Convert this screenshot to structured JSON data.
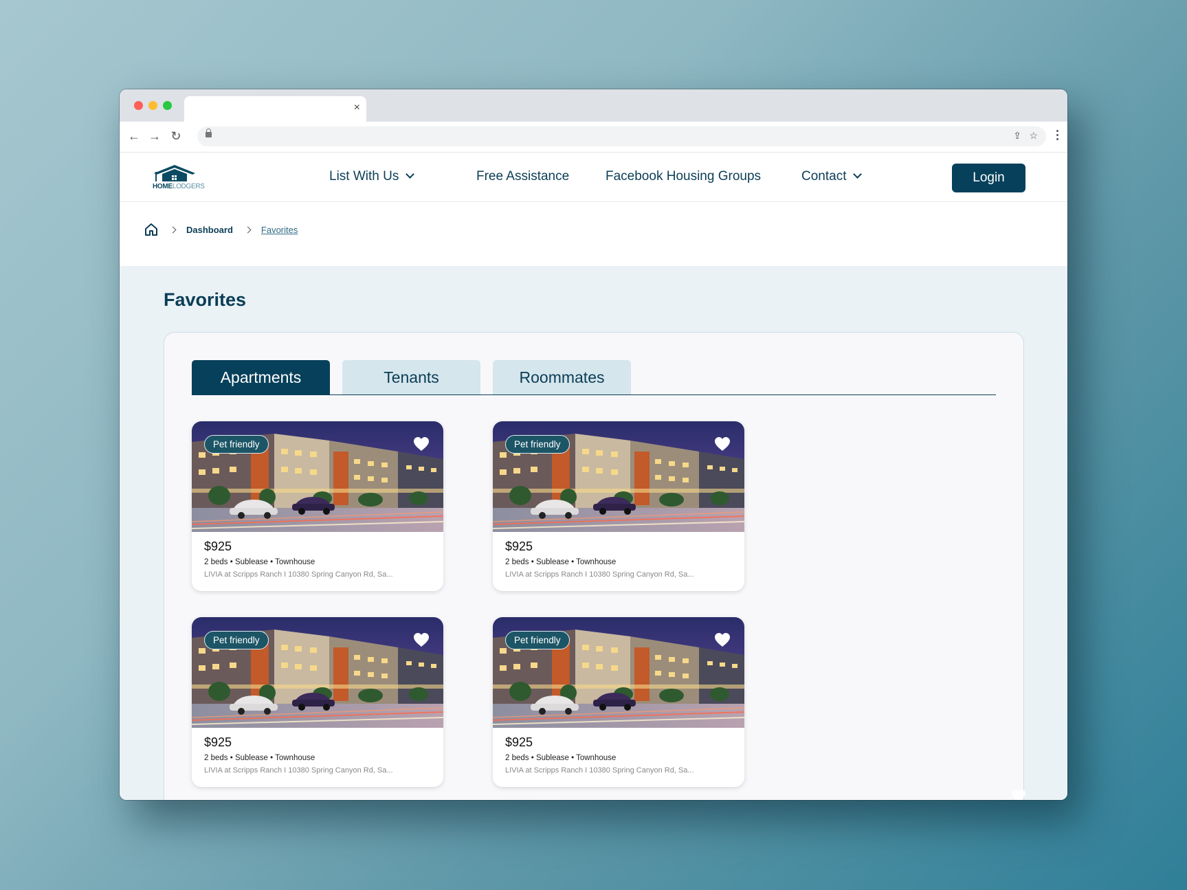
{
  "colors": {
    "brand_dark": "#07405a",
    "text_navy": "#0b3d56",
    "tab_inactive": "#d5e6ec",
    "badge": "#1c5566",
    "page_bg": "#eaf2f5"
  },
  "browser": {
    "tab_title": "",
    "close_glyph": "×",
    "back_glyph": "←",
    "forward_glyph": "→",
    "reload_glyph": "↻",
    "share_glyph": "⇪",
    "star_glyph": "☆"
  },
  "logo": {
    "text_bold": "HOME",
    "text_light": "LODGERS"
  },
  "nav": {
    "items": [
      {
        "label": "List With Us",
        "has_dropdown": true
      },
      {
        "label": "Free Assistance",
        "has_dropdown": false
      },
      {
        "label": "Facebook Housing Groups",
        "has_dropdown": false
      },
      {
        "label": "Contact",
        "has_dropdown": true
      }
    ],
    "login_label": "Login"
  },
  "breadcrumb": {
    "dashboard": "Dashboard",
    "current": "Favorites"
  },
  "page": {
    "title": "Favorites"
  },
  "tabs": [
    {
      "label": "Apartments",
      "active": true
    },
    {
      "label": "Tenants",
      "active": false
    },
    {
      "label": "Roommates",
      "active": false
    }
  ],
  "listings": [
    {
      "badge": "Pet friendly",
      "price": "$925",
      "meta": "2 beds • Sublease • Townhouse",
      "address": "LIVIA at Scripps Ranch I 10380 Spring Canyon Rd, Sa...",
      "favorited": true
    },
    {
      "badge": "Pet friendly",
      "price": "$925",
      "meta": "2 beds • Sublease • Townhouse",
      "address": "LIVIA at Scripps Ranch I 10380 Spring Canyon Rd, Sa...",
      "favorited": true
    },
    {
      "badge": "Pet friendly",
      "price": "$925",
      "meta": "2 beds • Sublease • Townhouse",
      "address": "LIVIA at Scripps Ranch I 10380 Spring Canyon Rd, Sa...",
      "favorited": true
    },
    {
      "badge": "Pet friendly",
      "price": "$925",
      "meta": "2 beds • Sublease • Townhouse",
      "address": "LIVIA at Scripps Ranch I 10380 Spring Canyon Rd, Sa...",
      "favorited": true
    }
  ]
}
